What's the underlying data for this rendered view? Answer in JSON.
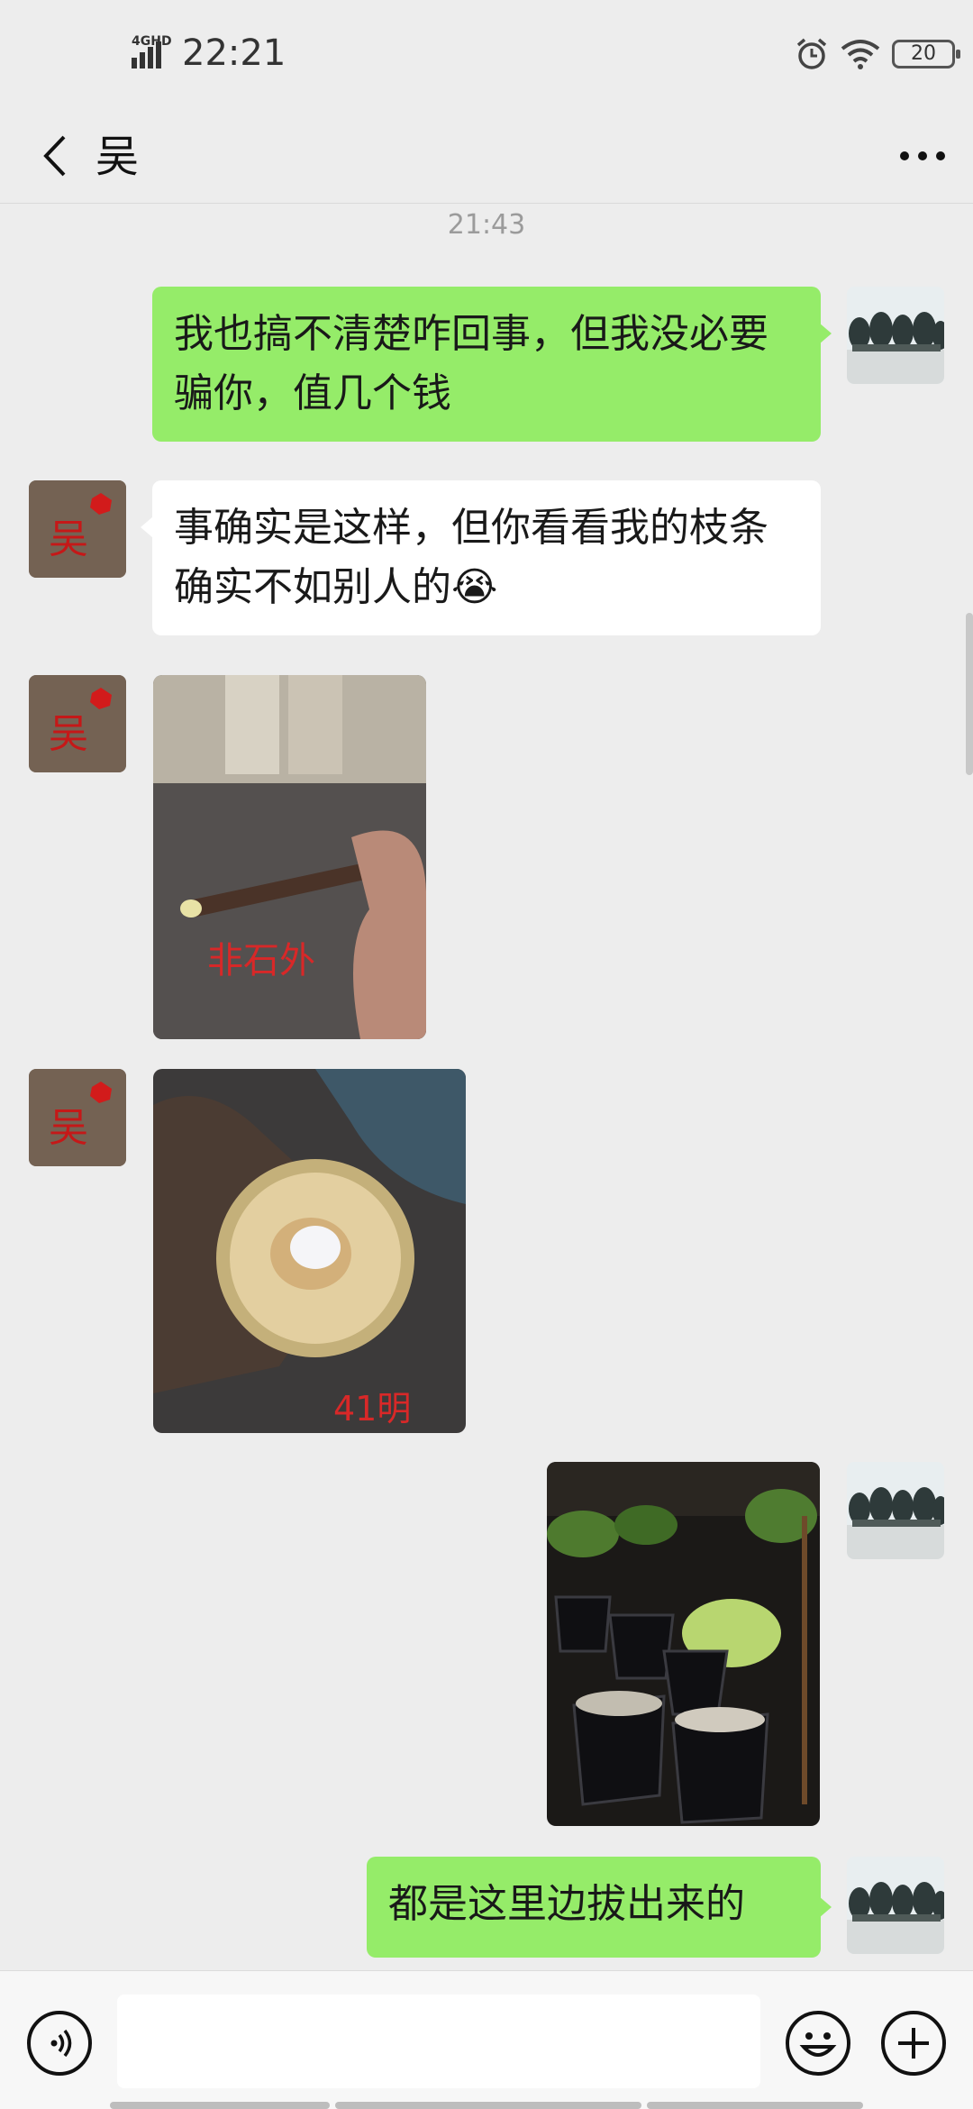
{
  "status_bar": {
    "network": "4GHD",
    "time": "22:21",
    "battery": "20",
    "icons": [
      "signal-icon",
      "alarm-icon",
      "wifi-icon",
      "battery-icon"
    ]
  },
  "header": {
    "title": "吴",
    "back_icon": "chevron-left-icon",
    "more_icon": "more-dots-icon"
  },
  "chat": {
    "timestamp": "21:43",
    "messages": [
      {
        "from": "me",
        "type": "text",
        "text": "我也搞不清楚咋回事，但我没必要骗你，值几个钱"
      },
      {
        "from": "them",
        "type": "text",
        "text": "事确实是这样，但你看看我的枝条确实不如别人的",
        "emoji": "😭"
      },
      {
        "from": "them",
        "type": "image",
        "image_text": "非石外"
      },
      {
        "from": "them",
        "type": "image",
        "image_text": "41明"
      },
      {
        "from": "me",
        "type": "image"
      },
      {
        "from": "me",
        "type": "text",
        "text": "都是这里边拔出来的"
      }
    ],
    "contact_avatar_text": "吴"
  },
  "input_bar": {
    "value": "",
    "icons": [
      "voice-icon",
      "emoji-icon",
      "plus-icon"
    ]
  },
  "colors": {
    "background": "#EDEDED",
    "sent_bubble": "#95EC69",
    "received_bubble": "#FFFFFF"
  }
}
